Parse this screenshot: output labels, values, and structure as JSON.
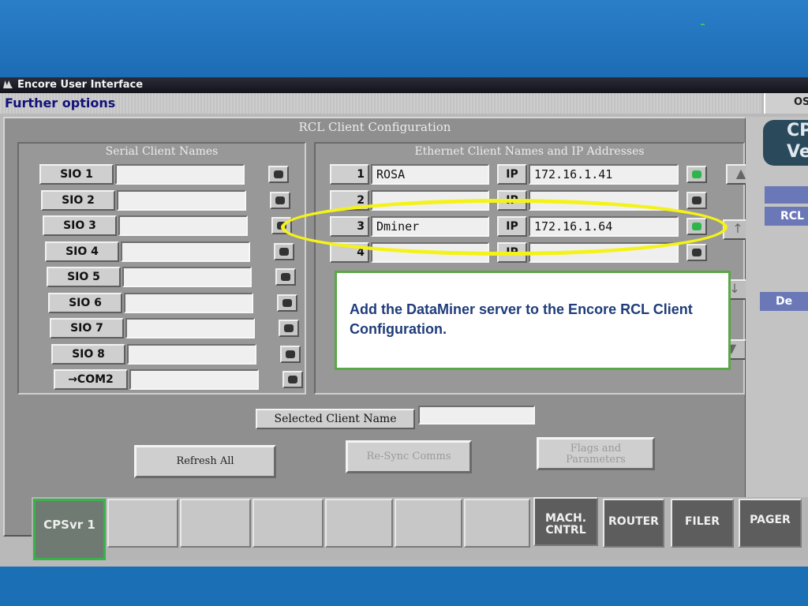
{
  "window": {
    "title": "Encore User Interface",
    "menu_label": "Further options",
    "os_tab": "OS"
  },
  "panel": {
    "title": "RCL Client Configuration",
    "serial_group_title": "Serial Client Names",
    "ethernet_group_title": "Ethernet Client Names and IP Addresses"
  },
  "serial_clients": [
    {
      "label": "SIO 1",
      "name": "",
      "led": "off"
    },
    {
      "label": "SIO 2",
      "name": "",
      "led": "off"
    },
    {
      "label": "SIO 3",
      "name": "",
      "led": "off"
    },
    {
      "label": "SIO 4",
      "name": "",
      "led": "off"
    },
    {
      "label": "SIO 5",
      "name": "",
      "led": "off"
    },
    {
      "label": "SIO 6",
      "name": "",
      "led": "off"
    },
    {
      "label": "SIO 7",
      "name": "",
      "led": "off"
    },
    {
      "label": "SIO 8",
      "name": "",
      "led": "off"
    },
    {
      "label": "→COM2",
      "name": "",
      "led": "off"
    }
  ],
  "ethernet_clients": [
    {
      "index": "1",
      "name": "ROSA",
      "ip_label": "IP",
      "ip": "172.16.1.41",
      "led": "on"
    },
    {
      "index": "2",
      "name": "",
      "ip_label": "IP",
      "ip": "",
      "led": "off"
    },
    {
      "index": "3",
      "name": "Dminer",
      "ip_label": "IP",
      "ip": "172.16.1.64",
      "led": "on"
    },
    {
      "index": "4",
      "name": "",
      "ip_label": "IP",
      "ip": "",
      "led": "off"
    }
  ],
  "selected_client": {
    "label": "Selected Client Name",
    "value": ""
  },
  "actions": {
    "refresh_all": "Refresh All",
    "resync": "Re-Sync Comms",
    "flags": "Flags and Parameters"
  },
  "right_panel": {
    "logo_text": "CP Ve",
    "btn_rcl": "RCL",
    "btn_d": "De"
  },
  "taskbar": {
    "cps_label": "CPSvr 1",
    "mach_cntrl": "MACH. CNTRL",
    "router": "ROUTER",
    "filer": "FILER",
    "pager": "PAGER"
  },
  "callout": {
    "text": "Add the DataMiner server to the Encore RCL Client Configuration."
  },
  "colors": {
    "highlight_ellipse": "#f5f21a",
    "callout_border": "#58a844",
    "callout_text": "#1f3c7a",
    "led_on": "#2db54a"
  }
}
